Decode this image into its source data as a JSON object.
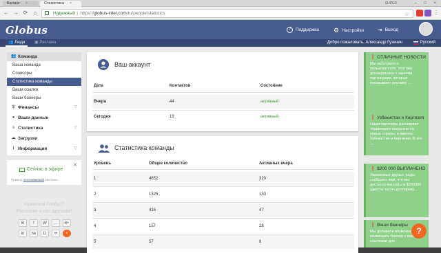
{
  "browser": {
    "tabs": [
      {
        "label": "Баланс"
      },
      {
        "label": "Статистика"
      }
    ],
    "window_label": "SUPER",
    "url": {
      "secure_label": "Надежный",
      "scheme": "https://",
      "host": "globus-inter.com",
      "path": "/ru/people/statistics"
    }
  },
  "header": {
    "logo": "Globus",
    "support": "Поддержка",
    "settings": "Настройки",
    "logout": "Выход"
  },
  "subbar": {
    "people": "Люди",
    "ads": "Реклама",
    "welcome": "Добро пожаловать, Александр Гузенин",
    "language": "Русский"
  },
  "sidebar": {
    "team_head": "Команда",
    "team_items": [
      "Ваша команда",
      "Спонсоры",
      "Статистика команды",
      "Ваши ссылки",
      "Ваши баннеры"
    ],
    "items": [
      "Финансы",
      "Ваши данные",
      "Статистика",
      "Загрузки",
      "Информация"
    ]
  },
  "onair": {
    "title": "Сейчас в эфире",
    "note_prefix": "Пример",
    "note_link": "оплачиваемой",
    "note_suffix": "рекламы"
  },
  "share": {
    "line1": "Нравится Глобус?",
    "line2": "Расскажи о нас друзьям!",
    "icons": [
      "B",
      "f",
      "W",
      "…",
      "8+",
      "in",
      "№",
      "Li",
      "••",
      "+"
    ]
  },
  "account": {
    "title": "Ваш аккаунт",
    "columns": [
      "Дата",
      "Контактов",
      "Состояние"
    ],
    "rows": [
      {
        "date": "Вчера",
        "contacts": "44",
        "state": "активный"
      },
      {
        "date": "Сегодня",
        "contacts": "19",
        "state": "активный"
      }
    ]
  },
  "team_stats": {
    "title": "Статистика команды",
    "columns": [
      "Уровень",
      "Общее количество",
      "Активных вчера"
    ],
    "rows": [
      {
        "level": "1",
        "total": "4652",
        "active": "320"
      },
      {
        "level": "2",
        "total": "1325",
        "active": "133"
      },
      {
        "level": "3",
        "total": "416",
        "active": "47"
      },
      {
        "level": "4",
        "total": "157",
        "active": "28"
      },
      {
        "level": "5",
        "total": "57",
        "active": "8"
      }
    ]
  },
  "news": [
    {
      "title": "ОТЛИЧНЫЕ НОВОСТИ",
      "body": "Мы заботимся о пользователях, поэтому договорились с нашими партнерами, которые показывают рекламу ..."
    },
    {
      "title": "Узбекистан и Киргизия",
      "body": "Наши партнеры расширяют территорию покрытия на новые страны, в именно Узбекистан и Киргизию. В эти ..."
    },
    {
      "title": "$200 000 ВЫПЛАЧЕНО",
      "body": "Уважаемые друзья, рады сообщить вам, что мы достигли выплаты в $200000 (двести тысяч долларов)..."
    },
    {
      "title": "Ваши баннеры",
      "body": "Мы добавили возможность размещать баннер с вашими ссылками для"
    }
  ],
  "help_button": "?"
}
